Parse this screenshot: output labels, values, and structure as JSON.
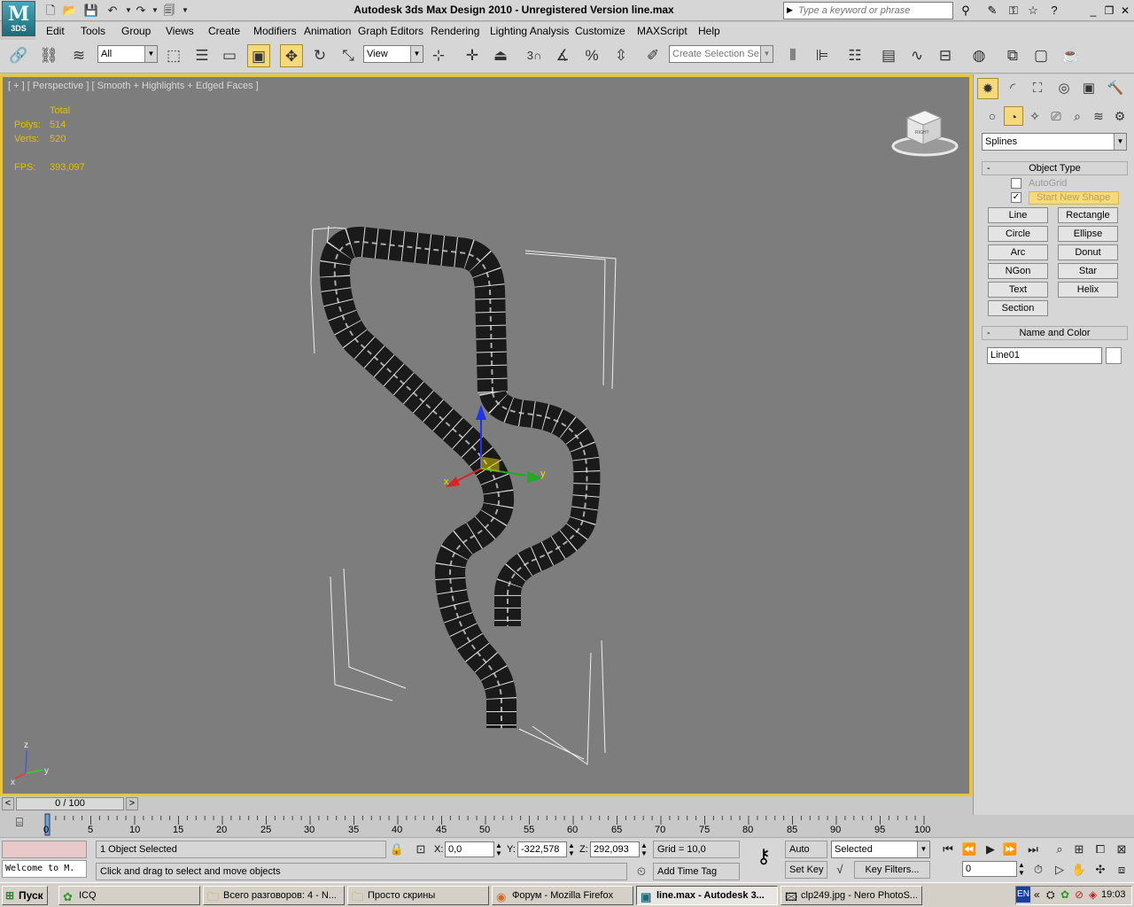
{
  "window": {
    "title": "Autodesk 3ds Max Design 2010  - Unregistered Version      line.max",
    "logo_text": "3DS",
    "search_placeholder": "Type a keyword or phrase"
  },
  "menu": [
    "Edit",
    "Tools",
    "Group",
    "Views",
    "Create",
    "Modifiers",
    "Animation",
    "Graph Editors",
    "Rendering",
    "Lighting Analysis",
    "Customize",
    "MAXScript",
    "Help"
  ],
  "toolbar": {
    "filter": "All",
    "ref_coord": "View",
    "selection_set_placeholder": "Create Selection Se",
    "snap_label": "3"
  },
  "viewport": {
    "label": "[ + ] [ Perspective ] [ Smooth + Highlights + Edged Faces ]",
    "stats_header": "Total",
    "polys_label": "Polys:",
    "polys_value": "514",
    "verts_label": "Verts:",
    "verts_value": "520",
    "fps_label": "FPS:",
    "fps_value": "393,097",
    "viewcube_label": "RIGHT",
    "gizmo_x": "x",
    "gizmo_y": "y",
    "axis_z": "z",
    "axis_y": "y",
    "axis_x": "x"
  },
  "command_panel": {
    "category": "Splines",
    "object_type_title": "Object Type",
    "autogrid_label": "AutoGrid",
    "start_new_shape_label": "Start New Shape",
    "start_new_shape_checked": true,
    "buttons": [
      "Line",
      "Rectangle",
      "Circle",
      "Ellipse",
      "Arc",
      "Donut",
      "NGon",
      "Star",
      "Text",
      "Helix",
      "Section"
    ],
    "name_color_title": "Name and Color",
    "object_name": "Line01"
  },
  "timeline": {
    "slider_label": "0 / 100",
    "ticks": [
      "0",
      "5",
      "10",
      "15",
      "20",
      "25",
      "30",
      "35",
      "40",
      "45",
      "50",
      "55",
      "60",
      "65",
      "70",
      "75",
      "80",
      "85",
      "90",
      "95",
      "100"
    ]
  },
  "status": {
    "maxscript_listener": "Welcome to M.",
    "selection_info": "1 Object Selected",
    "prompt": "Click and drag to select and move objects",
    "x_label": "X:",
    "x_value": "0,0",
    "y_label": "Y:",
    "y_value": "-322,578",
    "z_label": "Z:",
    "z_value": "292,093",
    "grid": "Grid = 10,0",
    "add_time_tag": "Add Time Tag",
    "auto_key": "Auto Key",
    "set_key": "Set Key",
    "key_mode": "Selected",
    "key_filters": "Key Filters...",
    "current_frame": "0"
  },
  "taskbar": {
    "start": "Пуск",
    "tasks": [
      "ICQ",
      "Всего разговоров: 4 - N...",
      "Просто скрины",
      "Форум - Mozilla Firefox",
      "line.max - Autodesk 3...",
      "clp249.jpg - Nero PhotoS..."
    ],
    "lang": "EN",
    "clock": "19:03"
  }
}
